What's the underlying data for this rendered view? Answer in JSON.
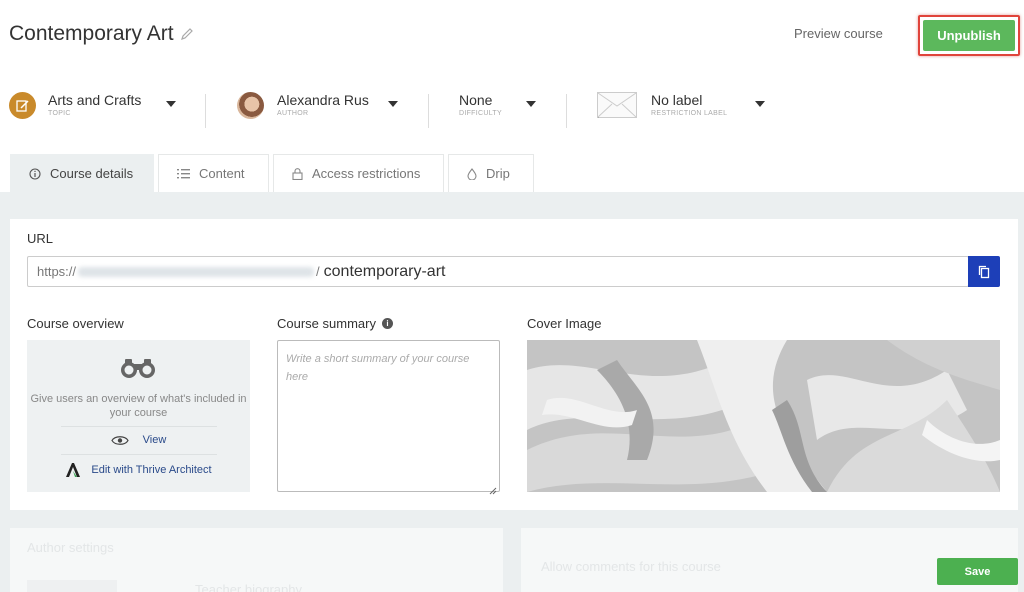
{
  "header": {
    "title": "Contemporary Art",
    "preview_label": "Preview course",
    "unpublish_label": "Unpublish"
  },
  "meta": {
    "topic": {
      "value": "Arts and Crafts",
      "sub": "TOPIC",
      "icon": "topic-icon"
    },
    "author": {
      "value": "Alexandra Rus",
      "sub": "AUTHOR",
      "icon": "avatar"
    },
    "difficulty": {
      "value": "None",
      "sub": "DIFFICULTY"
    },
    "restriction": {
      "value": "No label",
      "sub": "RESTRICTION LABEL",
      "icon": "label-icon"
    }
  },
  "tabs": [
    {
      "label": "Course details",
      "icon": "info-icon",
      "active": true
    },
    {
      "label": "Content",
      "icon": "list-icon",
      "active": false
    },
    {
      "label": "Access restrictions",
      "icon": "lock-icon",
      "active": false
    },
    {
      "label": "Drip",
      "icon": "drop-icon",
      "active": false
    }
  ],
  "url": {
    "label": "URL",
    "prefix": "https://",
    "slash": "/",
    "slug": "contemporary-art"
  },
  "overview": {
    "label": "Course overview",
    "description": "Give users an overview of what's included in your course",
    "view_label": "View",
    "edit_label": "Edit with Thrive Architect"
  },
  "summary": {
    "label": "Course summary",
    "placeholder": "Write a short summary of your course here"
  },
  "cover": {
    "label": "Cover Image"
  },
  "bottom": {
    "author_settings": "Author settings",
    "teacher_bio": "Teacher biography",
    "allow_comments": "Allow comments for this course",
    "save_label": "Save"
  },
  "colors": {
    "accent_green": "#5cb85c",
    "copy_blue": "#1d3fb8",
    "highlight_red": "#e0443b",
    "panel_gray": "#ebeff0"
  }
}
